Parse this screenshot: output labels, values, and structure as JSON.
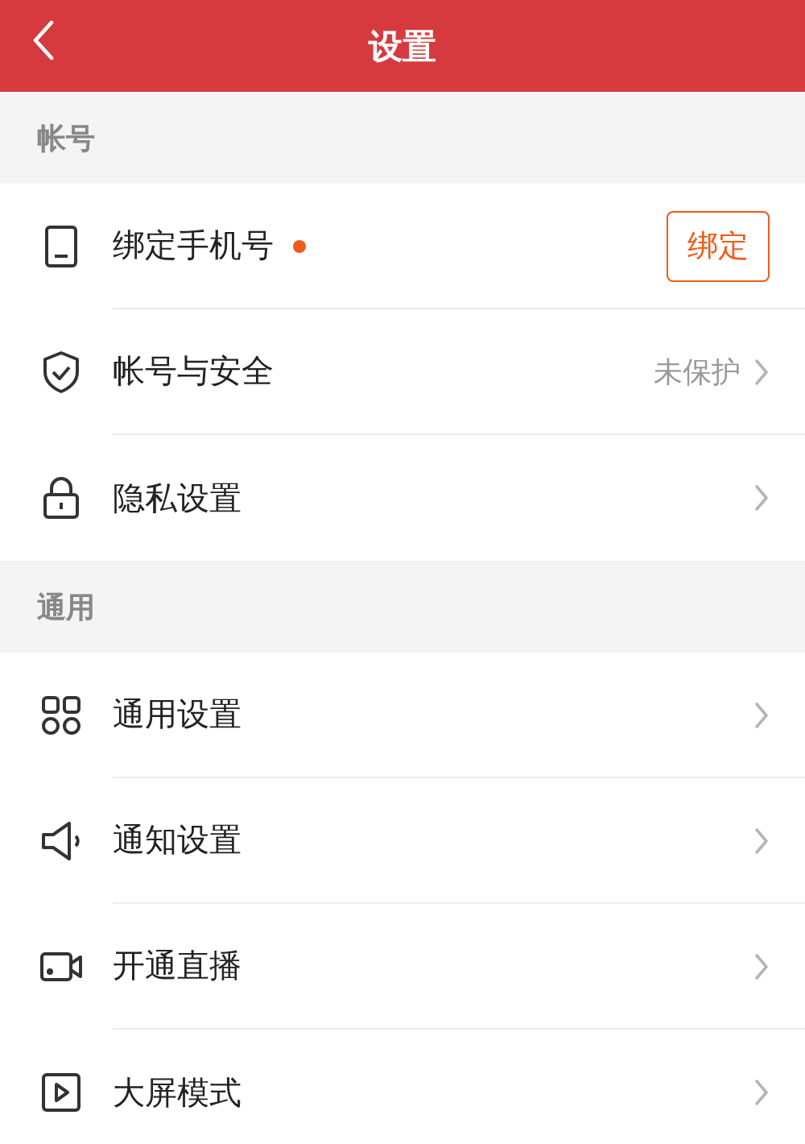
{
  "header": {
    "title": "设置"
  },
  "sections": [
    {
      "title": "帐号",
      "items": [
        {
          "kind": "button",
          "label": "绑定手机号",
          "dot": true,
          "action": "绑定"
        },
        {
          "kind": "link",
          "label": "帐号与安全",
          "value": "未保护"
        },
        {
          "kind": "link",
          "label": "隐私设置"
        }
      ]
    },
    {
      "title": "通用",
      "items": [
        {
          "kind": "link",
          "label": "通用设置"
        },
        {
          "kind": "link",
          "label": "通知设置"
        },
        {
          "kind": "link",
          "label": "开通直播"
        },
        {
          "kind": "link",
          "label": "大屏模式"
        }
      ]
    }
  ]
}
